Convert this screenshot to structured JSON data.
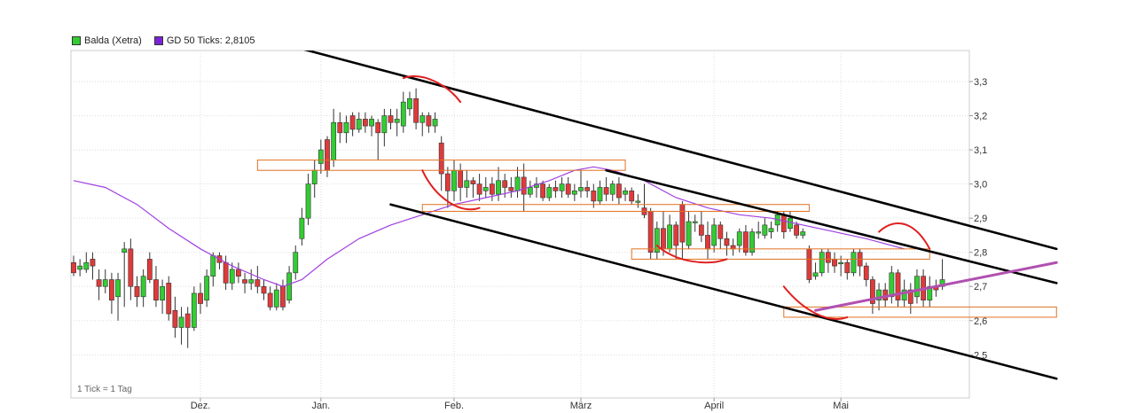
{
  "legend": {
    "series1_label": "Balda (Xetra)",
    "series2_label": "GD 50 Ticks: 2,8105",
    "series1_color": "#33cc33",
    "series2_color": "#7b22d6"
  },
  "footer_note": "1 Tick = 1 Tag",
  "colors": {
    "up": "#33cc33",
    "down": "#e03a3a",
    "ma": "#a040e0",
    "trendline": "#000000",
    "support_line": "#b050b0",
    "zone": "#e07020",
    "annotation": "#e02020",
    "grid": "#dddddd"
  },
  "chart_data": {
    "type": "candlestick",
    "title": "",
    "xlabel": "",
    "ylabel": "",
    "ylim": [
      2.44,
      3.39
    ],
    "y_ticks": [
      "3,3",
      "3,2",
      "3,1",
      "3,0",
      "2,9",
      "2,8",
      "2,7",
      "2,6",
      "2,5"
    ],
    "y_tick_values": [
      3.3,
      3.2,
      3.1,
      3.0,
      2.9,
      2.8,
      2.7,
      2.6,
      2.5
    ],
    "x_tick_labels": [
      "Dez.",
      "Jan.",
      "Feb.",
      "März",
      "April",
      "Mai"
    ],
    "x_tick_days": [
      20,
      39,
      60,
      80,
      101,
      121
    ],
    "grid": true,
    "x_axis": "trading days",
    "candles": [
      [
        2.77,
        2.74,
        2.79,
        2.73
      ],
      [
        2.75,
        2.76,
        2.78,
        2.73
      ],
      [
        2.75,
        2.77,
        2.8,
        2.74
      ],
      [
        2.78,
        2.76,
        2.8,
        2.72
      ],
      [
        2.72,
        2.7,
        2.75,
        2.66
      ],
      [
        2.7,
        2.72,
        2.75,
        2.68
      ],
      [
        2.72,
        2.66,
        2.74,
        2.62
      ],
      [
        2.67,
        2.72,
        2.74,
        2.6
      ],
      [
        2.8,
        2.81,
        2.83,
        2.64
      ],
      [
        2.81,
        2.7,
        2.84,
        2.66
      ],
      [
        2.7,
        2.67,
        2.73,
        2.64
      ],
      [
        2.67,
        2.73,
        2.75,
        2.64
      ],
      [
        2.78,
        2.72,
        2.8,
        2.71
      ],
      [
        2.72,
        2.66,
        2.76,
        2.64
      ],
      [
        2.66,
        2.7,
        2.72,
        2.62
      ],
      [
        2.71,
        2.62,
        2.73,
        2.6
      ],
      [
        2.63,
        2.58,
        2.67,
        2.55
      ],
      [
        2.58,
        2.61,
        2.64,
        2.53
      ],
      [
        2.62,
        2.58,
        2.64,
        2.52
      ],
      [
        2.58,
        2.68,
        2.7,
        2.57
      ],
      [
        2.68,
        2.65,
        2.71,
        2.62
      ],
      [
        2.66,
        2.73,
        2.75,
        2.64
      ],
      [
        2.73,
        2.79,
        2.8,
        2.7
      ],
      [
        2.79,
        2.77,
        2.8,
        2.75
      ],
      [
        2.77,
        2.71,
        2.79,
        2.69
      ],
      [
        2.71,
        2.75,
        2.77,
        2.69
      ],
      [
        2.75,
        2.73,
        2.77,
        2.71
      ],
      [
        2.72,
        2.71,
        2.74,
        2.68
      ],
      [
        2.71,
        2.72,
        2.75,
        2.69
      ],
      [
        2.72,
        2.7,
        2.76,
        2.68
      ],
      [
        2.7,
        2.68,
        2.72,
        2.66
      ],
      [
        2.68,
        2.64,
        2.7,
        2.63
      ],
      [
        2.64,
        2.69,
        2.71,
        2.63
      ],
      [
        2.7,
        2.64,
        2.72,
        2.63
      ],
      [
        2.66,
        2.74,
        2.76,
        2.65
      ],
      [
        2.74,
        2.8,
        2.82,
        2.72
      ],
      [
        2.84,
        2.9,
        2.93,
        2.82
      ],
      [
        2.9,
        3.0,
        3.03,
        2.88
      ],
      [
        3.0,
        3.04,
        3.07,
        2.96
      ],
      [
        3.06,
        3.1,
        3.13,
        3.03
      ],
      [
        3.13,
        3.04,
        3.14,
        3.02
      ],
      [
        3.07,
        3.18,
        3.22,
        3.05
      ],
      [
        3.18,
        3.15,
        3.21,
        3.12
      ],
      [
        3.15,
        3.18,
        3.2,
        3.12
      ],
      [
        3.2,
        3.16,
        3.21,
        3.14
      ],
      [
        3.16,
        3.19,
        3.21,
        3.15
      ],
      [
        3.19,
        3.17,
        3.21,
        3.15
      ],
      [
        3.17,
        3.19,
        3.2,
        3.14
      ],
      [
        3.18,
        3.15,
        3.19,
        3.07
      ],
      [
        3.15,
        3.2,
        3.22,
        3.11
      ],
      [
        3.2,
        3.18,
        3.22,
        3.16
      ],
      [
        3.18,
        3.19,
        3.22,
        3.14
      ],
      [
        3.17,
        3.24,
        3.27,
        3.15
      ],
      [
        3.22,
        3.25,
        3.27,
        3.2
      ],
      [
        3.25,
        3.18,
        3.28,
        3.16
      ],
      [
        3.18,
        3.2,
        3.21,
        3.14
      ],
      [
        3.2,
        3.17,
        3.21,
        3.15
      ],
      [
        3.17,
        3.19,
        3.21,
        3.15
      ],
      [
        3.12,
        3.03,
        3.14,
        2.98
      ],
      [
        3.03,
        2.98,
        3.05,
        2.93
      ],
      [
        2.98,
        3.04,
        3.07,
        2.95
      ],
      [
        3.04,
        2.99,
        3.06,
        2.95
      ],
      [
        2.99,
        3.01,
        3.04,
        2.96
      ],
      [
        3.01,
        3.0,
        3.02,
        2.96
      ],
      [
        3.0,
        2.97,
        3.03,
        2.95
      ],
      [
        2.98,
        2.99,
        3.02,
        2.96
      ],
      [
        3.0,
        2.97,
        3.02,
        2.95
      ],
      [
        2.97,
        3.01,
        3.05,
        2.95
      ],
      [
        3.01,
        2.99,
        3.03,
        2.96
      ],
      [
        2.99,
        2.98,
        3.02,
        2.96
      ],
      [
        2.98,
        3.02,
        3.05,
        2.96
      ],
      [
        3.02,
        2.97,
        3.06,
        2.92
      ],
      [
        2.97,
        2.99,
        3.01,
        2.96
      ],
      [
        2.99,
        3.0,
        3.02,
        2.96
      ],
      [
        3.0,
        2.96,
        3.01,
        2.95
      ],
      [
        2.96,
        2.99,
        3.0,
        2.95
      ],
      [
        2.99,
        2.98,
        3.01,
        2.96
      ],
      [
        2.98,
        3.0,
        3.02,
        2.96
      ],
      [
        3.0,
        2.97,
        3.02,
        2.96
      ],
      [
        2.97,
        2.98,
        3.0,
        2.95
      ],
      [
        2.98,
        2.99,
        3.04,
        2.96
      ],
      [
        2.99,
        2.98,
        3.01,
        2.96
      ],
      [
        2.98,
        2.95,
        3.0,
        2.93
      ],
      [
        2.95,
        2.99,
        3.01,
        2.94
      ],
      [
        2.99,
        2.97,
        3.02,
        2.95
      ],
      [
        2.97,
        3.0,
        3.01,
        2.95
      ],
      [
        3.0,
        2.96,
        3.02,
        2.94
      ],
      [
        2.97,
        2.98,
        2.99,
        2.95
      ],
      [
        2.98,
        2.95,
        2.99,
        2.94
      ],
      [
        2.95,
        2.95,
        2.97,
        2.93
      ],
      [
        2.93,
        2.91,
        3.0,
        2.9
      ],
      [
        2.92,
        2.8,
        2.93,
        2.78
      ],
      [
        2.8,
        2.87,
        2.89,
        2.78
      ],
      [
        2.87,
        2.81,
        2.92,
        2.79
      ],
      [
        2.81,
        2.88,
        2.91,
        2.8
      ],
      [
        2.88,
        2.82,
        2.89,
        2.78
      ],
      [
        2.94,
        2.83,
        2.95,
        2.78
      ],
      [
        2.82,
        2.89,
        2.92,
        2.81
      ],
      [
        2.89,
        2.89,
        2.91,
        2.86
      ],
      [
        2.88,
        2.85,
        2.92,
        2.83
      ],
      [
        2.85,
        2.81,
        2.89,
        2.78
      ],
      [
        2.82,
        2.88,
        2.9,
        2.8
      ],
      [
        2.88,
        2.84,
        2.89,
        2.81
      ],
      [
        2.84,
        2.82,
        2.86,
        2.79
      ],
      [
        2.82,
        2.81,
        2.84,
        2.79
      ],
      [
        2.82,
        2.86,
        2.87,
        2.8
      ],
      [
        2.86,
        2.8,
        2.88,
        2.79
      ],
      [
        2.8,
        2.86,
        2.87,
        2.79
      ],
      [
        2.86,
        2.86,
        2.89,
        2.84
      ],
      [
        2.85,
        2.88,
        2.9,
        2.84
      ],
      [
        2.86,
        2.87,
        2.89,
        2.84
      ],
      [
        2.88,
        2.91,
        2.92,
        2.86
      ],
      [
        2.91,
        2.86,
        2.92,
        2.84
      ],
      [
        2.87,
        2.9,
        2.92,
        2.86
      ],
      [
        2.88,
        2.85,
        2.89,
        2.84
      ],
      [
        2.85,
        2.86,
        2.87,
        2.84
      ],
      [
        2.81,
        2.72,
        2.82,
        2.71
      ],
      [
        2.73,
        2.74,
        2.77,
        2.72
      ],
      [
        2.74,
        2.8,
        2.81,
        2.73
      ],
      [
        2.8,
        2.77,
        2.81,
        2.74
      ],
      [
        2.78,
        2.76,
        2.8,
        2.74
      ],
      [
        2.77,
        2.77,
        2.79,
        2.73
      ],
      [
        2.77,
        2.74,
        2.78,
        2.72
      ],
      [
        2.74,
        2.8,
        2.81,
        2.73
      ],
      [
        2.8,
        2.76,
        2.81,
        2.73
      ],
      [
        2.76,
        2.72,
        2.77,
        2.7
      ],
      [
        2.72,
        2.65,
        2.73,
        2.62
      ],
      [
        2.66,
        2.69,
        2.71,
        2.63
      ],
      [
        2.69,
        2.66,
        2.71,
        2.64
      ],
      [
        2.67,
        2.74,
        2.76,
        2.65
      ],
      [
        2.74,
        2.66,
        2.75,
        2.64
      ],
      [
        2.66,
        2.69,
        2.72,
        2.64
      ],
      [
        2.69,
        2.65,
        2.71,
        2.62
      ],
      [
        2.67,
        2.73,
        2.75,
        2.65
      ],
      [
        2.73,
        2.66,
        2.75,
        2.64
      ],
      [
        2.66,
        2.7,
        2.73,
        2.64
      ],
      [
        2.7,
        2.69,
        2.72,
        2.67
      ],
      [
        2.7,
        2.72,
        2.78,
        2.69
      ]
    ],
    "moving_average": [
      [
        0,
        3.01
      ],
      [
        5,
        2.99
      ],
      [
        10,
        2.94
      ],
      [
        15,
        2.87
      ],
      [
        20,
        2.81
      ],
      [
        25,
        2.76
      ],
      [
        30,
        2.72
      ],
      [
        33,
        2.7
      ],
      [
        36,
        2.72
      ],
      [
        40,
        2.78
      ],
      [
        45,
        2.84
      ],
      [
        50,
        2.88
      ],
      [
        55,
        2.91
      ],
      [
        60,
        2.94
      ],
      [
        65,
        2.96
      ],
      [
        70,
        2.98
      ],
      [
        75,
        3.01
      ],
      [
        79,
        3.04
      ],
      [
        82,
        3.05
      ],
      [
        85,
        3.04
      ],
      [
        90,
        3.01
      ],
      [
        95,
        2.96
      ],
      [
        100,
        2.93
      ],
      [
        105,
        2.91
      ],
      [
        110,
        2.9
      ],
      [
        115,
        2.88
      ],
      [
        120,
        2.86
      ],
      [
        125,
        2.84
      ],
      [
        131,
        2.81
      ]
    ],
    "trendlines": [
      {
        "points": [
          [
            29,
            3.43
          ],
          [
            155,
            2.81
          ]
        ],
        "color": "black"
      },
      {
        "points": [
          [
            84,
            3.04
          ],
          [
            155,
            2.71
          ]
        ],
        "color": "black"
      },
      {
        "points": [
          [
            50,
            2.94
          ],
          [
            155,
            2.43
          ]
        ],
        "color": "black"
      },
      {
        "points": [
          [
            117,
            2.63
          ],
          [
            155,
            2.77
          ]
        ],
        "color": "purple"
      }
    ],
    "zones": [
      {
        "x": [
          29,
          87
        ],
        "y": [
          3.04,
          3.07
        ]
      },
      {
        "x": [
          55,
          116
        ],
        "y": [
          2.92,
          2.94
        ]
      },
      {
        "x": [
          88,
          135
        ],
        "y": [
          2.78,
          2.81
        ]
      },
      {
        "x": [
          112,
          155
        ],
        "y": [
          2.61,
          2.64
        ]
      }
    ]
  }
}
